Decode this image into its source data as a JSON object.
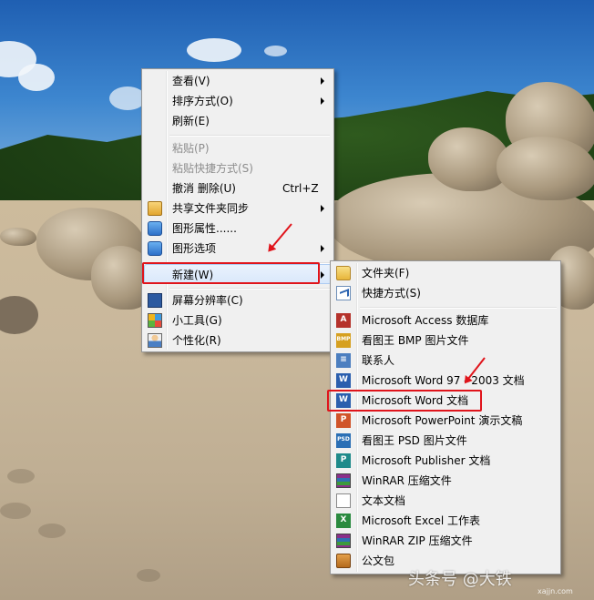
{
  "context_menu": {
    "items": [
      {
        "label": "查看(V)",
        "submenu": true
      },
      {
        "label": "排序方式(O)",
        "submenu": true
      },
      {
        "label": "刷新(E)"
      },
      {
        "label": "粘贴(P)",
        "disabled": true
      },
      {
        "label": "粘贴快捷方式(S)",
        "disabled": true
      },
      {
        "label": "撤消 删除(U)",
        "shortcut": "Ctrl+Z"
      },
      {
        "label": "共享文件夹同步",
        "submenu": true,
        "icon": "share-sync-icon"
      },
      {
        "label": "图形属性......",
        "icon": "graphics-properties-icon"
      },
      {
        "label": "图形选项",
        "submenu": true,
        "icon": "graphics-options-icon"
      },
      {
        "label": "新建(W)",
        "submenu": true,
        "highlighted": true
      },
      {
        "label": "屏幕分辨率(C)",
        "icon": "monitor-icon"
      },
      {
        "label": "小工具(G)",
        "icon": "gadgets-icon"
      },
      {
        "label": "个性化(R)",
        "icon": "personalize-icon"
      }
    ]
  },
  "new_submenu": {
    "items": [
      {
        "label": "文件夹(F)",
        "icon": "folder-icon"
      },
      {
        "label": "快捷方式(S)",
        "icon": "shortcut-icon"
      },
      {
        "label": "Microsoft Access 数据库",
        "icon": "access-icon"
      },
      {
        "label": "看图王 BMP 图片文件",
        "icon": "bmp-icon"
      },
      {
        "label": "联系人",
        "icon": "contact-icon"
      },
      {
        "label": "Microsoft Word 97 - 2003 文档",
        "icon": "word-icon"
      },
      {
        "label": "Microsoft Word 文档",
        "icon": "word-icon",
        "highlighted": true
      },
      {
        "label": "Microsoft PowerPoint 演示文稿",
        "icon": "powerpoint-icon"
      },
      {
        "label": "看图王 PSD 图片文件",
        "icon": "psd-icon"
      },
      {
        "label": "Microsoft Publisher 文档",
        "icon": "publisher-icon"
      },
      {
        "label": "WinRAR 压缩文件",
        "icon": "winrar-icon"
      },
      {
        "label": "文本文档",
        "icon": "text-document-icon"
      },
      {
        "label": "Microsoft Excel 工作表",
        "icon": "excel-icon"
      },
      {
        "label": "WinRAR ZIP 压缩文件",
        "icon": "winrar-zip-icon"
      },
      {
        "label": "公文包",
        "icon": "briefcase-icon"
      }
    ]
  },
  "icon_letters": {
    "access": "A",
    "bmp": "BMP",
    "contact": "≡",
    "word": "W",
    "ppt": "P",
    "psd": "PSD",
    "pub": "P",
    "excel": "X"
  },
  "watermark": {
    "text": "头条号 @大铁",
    "site": "xajjn.com"
  }
}
